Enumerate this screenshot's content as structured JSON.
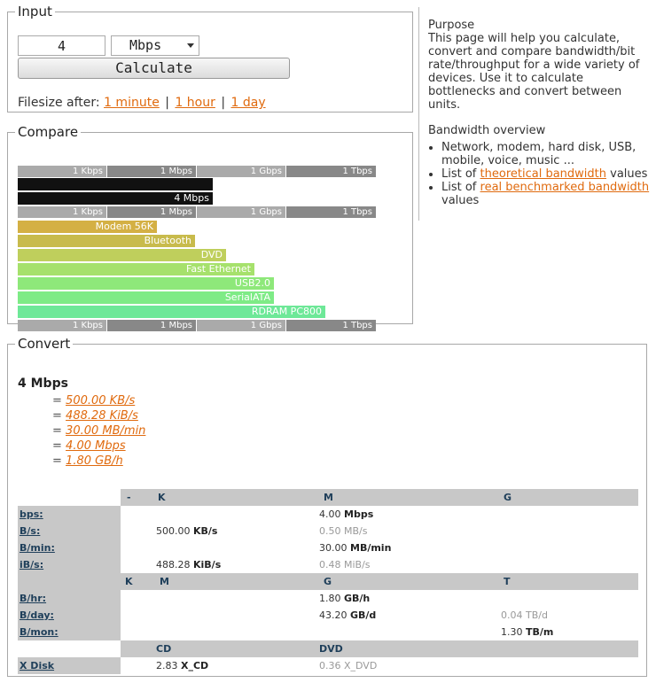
{
  "input": {
    "legend": "Input",
    "value": "4",
    "unit": "Mbps",
    "calculate_label": "Calculate",
    "filesize_label": "Filesize after:",
    "links": [
      "1 minute",
      "1 hour",
      "1 day"
    ],
    "separator": "|"
  },
  "purpose": {
    "heading": "Purpose",
    "text": "This page will help you calculate, convert and compare bandwidth/bit rate/throughput for a wide variety of devices. Use it to calculate bottlenecks and convert between units.",
    "overview_heading": "Bandwidth overview",
    "item1": "Network, modem, hard disk, USB, mobile, voice, music ...",
    "item2_pre": "List of ",
    "item2_link": "theoretical bandwidth",
    "item2_post": " values",
    "item3_pre": "List of ",
    "item3_link": "real benchmarked bandwidth",
    "item3_post": " values"
  },
  "compare": {
    "legend": "Compare",
    "axis_labels": [
      "1 Kbps",
      "1 Mbps",
      "1 Gbps",
      "1 Tbps"
    ],
    "current_label": "4 Mbps",
    "devices": [
      {
        "name": "Modem 56K",
        "color": "#d4b044"
      },
      {
        "name": "Bluetooth",
        "color": "#c8bb4c"
      },
      {
        "name": "DVD",
        "color": "#bfcf5c"
      },
      {
        "name": "Fast Ethernet",
        "color": "#a6e16c"
      },
      {
        "name": "USB2.0",
        "color": "#8ee87a"
      },
      {
        "name": "SerialATA",
        "color": "#7eeb86"
      },
      {
        "name": "RDRAM PC800",
        "color": "#6ee898"
      }
    ]
  },
  "convert": {
    "legend": "Convert",
    "heading": "4 Mbps",
    "equals": [
      "500.00 KB/s",
      "488.28 KiB/s",
      "30.00 MB/min",
      "4.00 Mbps",
      "1.80 GB/h"
    ],
    "eq_sign": "=",
    "header1": [
      "-",
      "K",
      "M",
      "G"
    ],
    "header2": [
      "K",
      "M",
      "G",
      "T"
    ],
    "header3": [
      "CD",
      "DVD"
    ],
    "rows1": [
      {
        "label": "bps:",
        "k": "",
        "m_num": "4.00",
        "m_unit": "Mbps",
        "g": ""
      },
      {
        "label": "B/s:",
        "k_num": "500.00",
        "k_unit": "KB/s",
        "m_gray": "0.50 MB/s"
      },
      {
        "label": "B/min:",
        "m_num": "30.00",
        "m_unit": "MB/min"
      },
      {
        "label": "iB/s:",
        "k_num": "488.28",
        "k_unit": "KiB/s",
        "m_gray": "0.48 MiB/s"
      }
    ],
    "rows2": [
      {
        "label": "B/hr:",
        "g_num": "1.80",
        "g_unit": "GB/h"
      },
      {
        "label": "B/day:",
        "g_num": "43.20",
        "g_unit": "GB/d",
        "t_gray": "0.04 TB/d"
      },
      {
        "label": "B/mon:",
        "t_num": "1.30",
        "t_unit": "TB/m"
      }
    ],
    "disk": {
      "label": "X Disk",
      "cd_num": "2.83",
      "cd_unit": "X_CD",
      "dvd_gray": "0.36 X_DVD"
    }
  }
}
